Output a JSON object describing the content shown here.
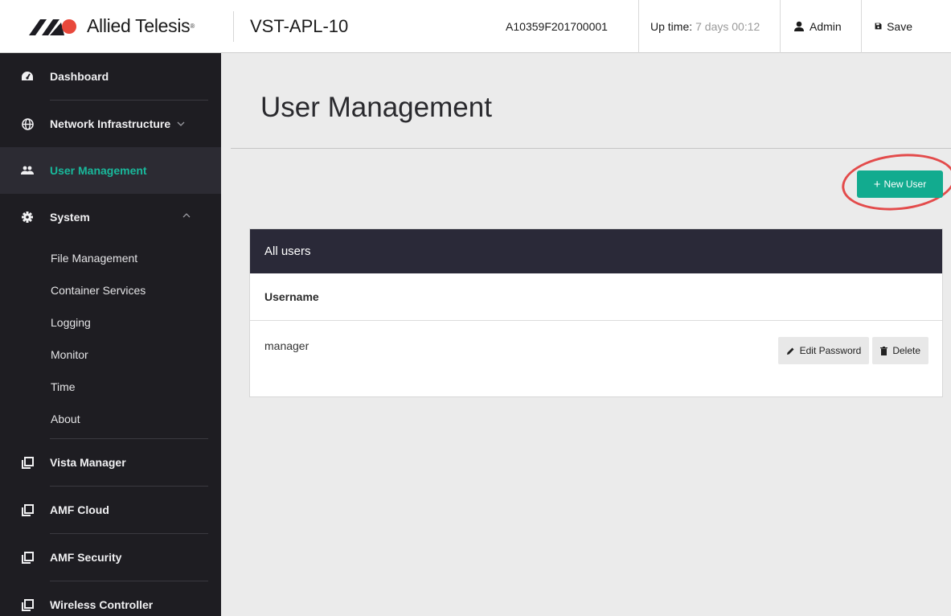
{
  "header": {
    "brand_name": "Allied Telesis",
    "brand_mark": "®",
    "device_name": "VST-APL-10",
    "serial": "A10359F201700001",
    "uptime_label": "Up time:",
    "uptime_value": "7 days 00:12",
    "user_label": "Admin",
    "save_label": "Save",
    "brand_colors": {
      "dark": "#1d1c22",
      "accent": "#e8483b"
    }
  },
  "sidebar": {
    "items": [
      {
        "label": "Dashboard",
        "icon": "dashboard-icon"
      },
      {
        "label": "Network Infrastructure",
        "icon": "globe-icon"
      },
      {
        "label": "User Management",
        "icon": "users-icon"
      },
      {
        "label": "System",
        "icon": "gear-icon"
      },
      {
        "label": "Vista Manager",
        "icon": "window-icon"
      },
      {
        "label": "AMF Cloud",
        "icon": "window-icon"
      },
      {
        "label": "AMF Security",
        "icon": "window-icon"
      },
      {
        "label": "Wireless Controller",
        "icon": "window-icon"
      }
    ],
    "system_sub": [
      "File Management",
      "Container Services",
      "Logging",
      "Monitor",
      "Time",
      "About"
    ],
    "active_color": "#19b89b"
  },
  "main": {
    "title": "User Management",
    "new_user_label": "New User",
    "panel": {
      "title": "All users",
      "column": "Username",
      "rows": [
        {
          "username": "manager",
          "edit_label": "Edit Password",
          "delete_label": "Delete"
        }
      ]
    },
    "accent_color": "#12ab8f",
    "highlight_color": "#e34b4b"
  }
}
